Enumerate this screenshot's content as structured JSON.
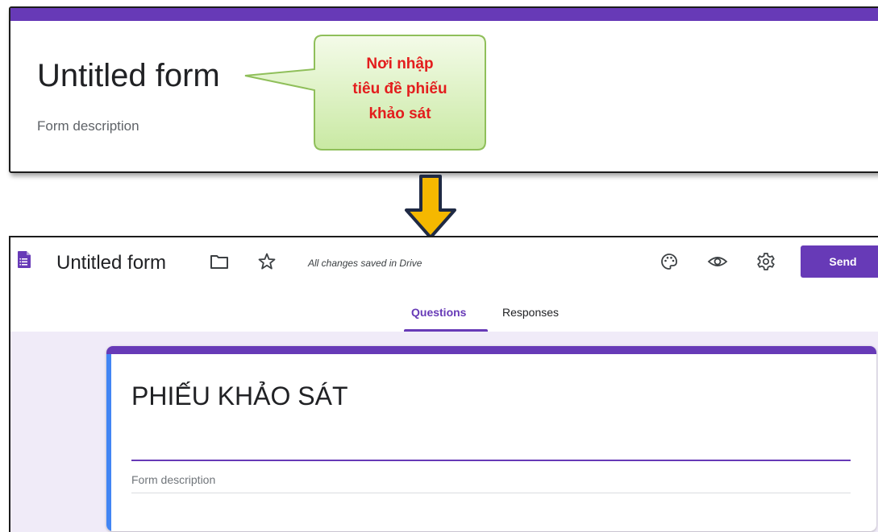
{
  "original_form": {
    "title": "Untitled form",
    "description": "Form description"
  },
  "callout": {
    "lines": [
      "Nơi nhập",
      "tiêu đề phiếu",
      "khảo sát"
    ],
    "text_color": "#e31d1d",
    "fill_color": "#d6f0b4"
  },
  "editor": {
    "app_title": "Untitled form",
    "save_status": "All changes saved in Drive",
    "send_label": "Send",
    "tabs": [
      {
        "label": "Questions",
        "active": true
      },
      {
        "label": "Responses",
        "active": false
      }
    ],
    "form_title": "PHIẾU KHẢO SÁT",
    "form_description": "Form description"
  },
  "icons": [
    "forms-doc-icon",
    "folder-icon",
    "star-icon",
    "palette-icon",
    "eye-icon",
    "gear-icon",
    "down-arrow-icon"
  ],
  "colors": {
    "accent": "#673ab7",
    "background": "#f0ebf8",
    "arrow_fill": "#f5b800",
    "arrow_outline": "#1f2a44"
  }
}
